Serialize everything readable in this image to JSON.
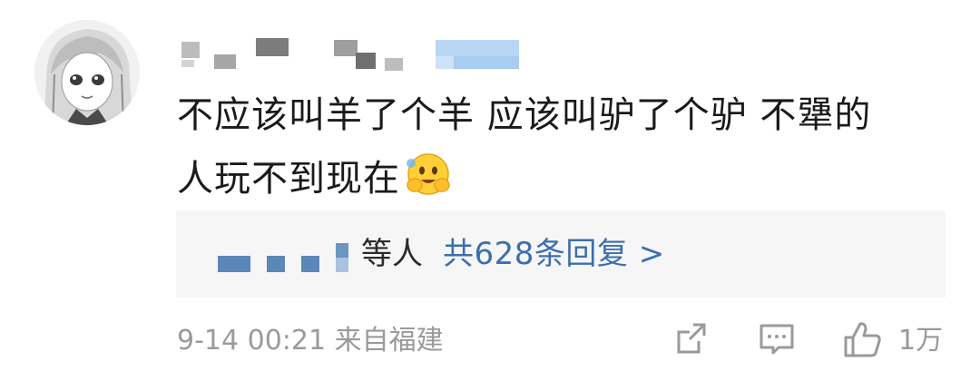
{
  "comment": {
    "line1": "不应该叫羊了个羊 应该叫驴了个驴 不犟的",
    "line2": "人玩不到现在",
    "emoji": "hugging-face-emoji"
  },
  "reply_summary": {
    "author_suffix": "等人",
    "link_text": "共628条回复 >",
    "total_replies": 628
  },
  "footer": {
    "timestamp": "9-14 00:21",
    "location": "来自福建",
    "like_count": "1万"
  },
  "icons": {
    "share": "share-icon",
    "comment": "comment-icon",
    "like": "thumbs-up-icon"
  },
  "colors": {
    "link": "#3d6fad",
    "meta": "#9a9a9a",
    "text": "#1a1a1a",
    "reply_bg": "#f6f6f6"
  }
}
